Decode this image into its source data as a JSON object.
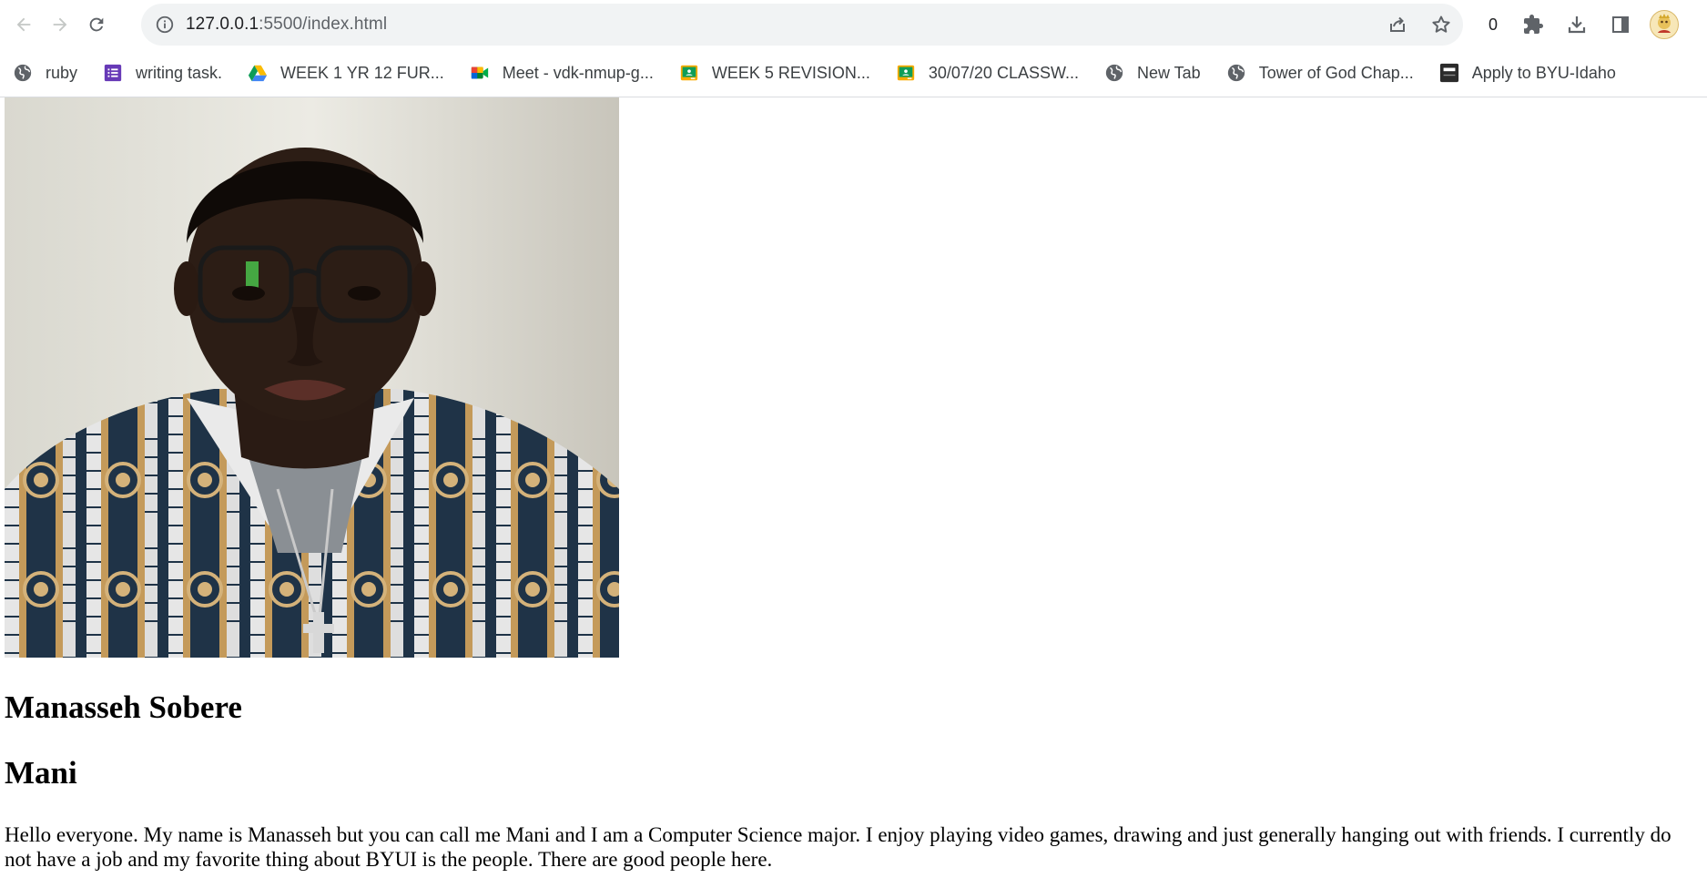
{
  "browser": {
    "url_host": "127.0.0.1",
    "url_path": ":5500/index.html",
    "extension_badge_count": "0",
    "icons": {
      "back": "arrow-left-icon",
      "forward": "arrow-right-icon",
      "reload": "reload-icon",
      "site_info": "info-icon",
      "share": "share-icon",
      "bookmark_star": "star-icon",
      "extensions": "puzzle-icon",
      "downloads": "download-icon",
      "side_panel": "side-panel-icon",
      "profile": "avatar-icon"
    }
  },
  "bookmarks": [
    {
      "label": "ruby",
      "icon": "globe-icon"
    },
    {
      "label": "writing task.",
      "icon": "forms-icon"
    },
    {
      "label": "WEEK 1 YR 12 FUR...",
      "icon": "drive-icon"
    },
    {
      "label": "Meet - vdk-nmup-g...",
      "icon": "meet-icon"
    },
    {
      "label": "WEEK 5 REVISION...",
      "icon": "classroom-icon"
    },
    {
      "label": "30/07/20 CLASSW...",
      "icon": "classroom-icon"
    },
    {
      "label": "New Tab",
      "icon": "globe-icon"
    },
    {
      "label": "Tower of God Chap...",
      "icon": "globe-icon"
    },
    {
      "label": "Apply to BYU-Idaho",
      "icon": "byu-icon"
    }
  ],
  "page": {
    "photo_icon": "profile-photo",
    "name": "Manasseh Sobere",
    "nickname": "Mani",
    "bio": "Hello everyone. My name is Manasseh but you can call me Mani and I am a Computer Science major. I enjoy playing video games, drawing and just generally hanging out with friends. I currently do not have a job and my favorite thing about BYUI is the people. There are good people here."
  },
  "colors": {
    "omnibox_bg": "#f1f3f4",
    "icon_gray": "#5f6368",
    "text": "#000000"
  }
}
